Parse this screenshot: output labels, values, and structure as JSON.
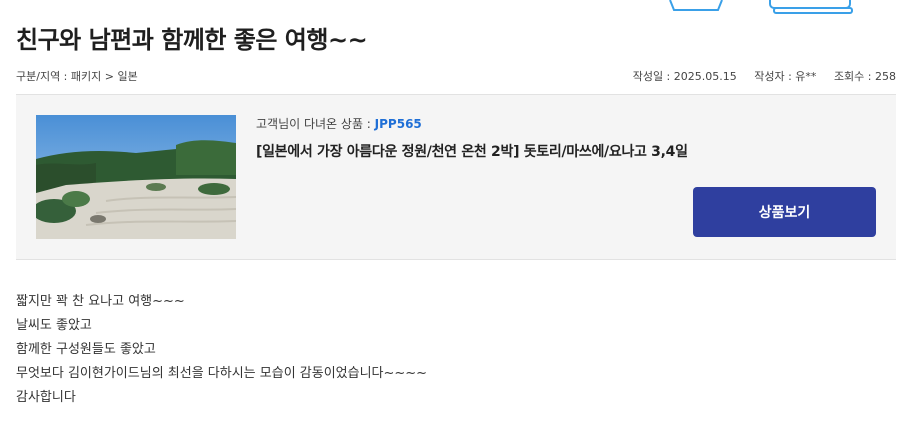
{
  "post": {
    "title": "친구와 남편과 함께한 좋은 여행~~",
    "category": "구분/지역 : 패키지 > 일본",
    "date": "작성일 : 2025.05.15",
    "author": "작성자 : 유**",
    "views": "조회수 : 258"
  },
  "product": {
    "label_prefix": "고객님이 다녀온 상품 : ",
    "code": "JPP565",
    "title": "[일본에서 가장 아름다운 정원/천연 온천 2박] 돗토리/마쓰에/요나고 3,4일",
    "button_label": "상품보기"
  },
  "content": {
    "lines": [
      "짧지만 꽉 찬 요나고 여행~~~",
      "날씨도 좋았고",
      "함께한 구성원들도 좋았고",
      "무엇보다 김이현가이드님의 최선을 다하시는 모습이 감동이었습니다~~~~",
      "감사합니다"
    ]
  },
  "colors": {
    "accent_blue": "#1f6fd6",
    "button_bg": "#2f3f9f",
    "panel_bg": "#f5f5f5"
  }
}
